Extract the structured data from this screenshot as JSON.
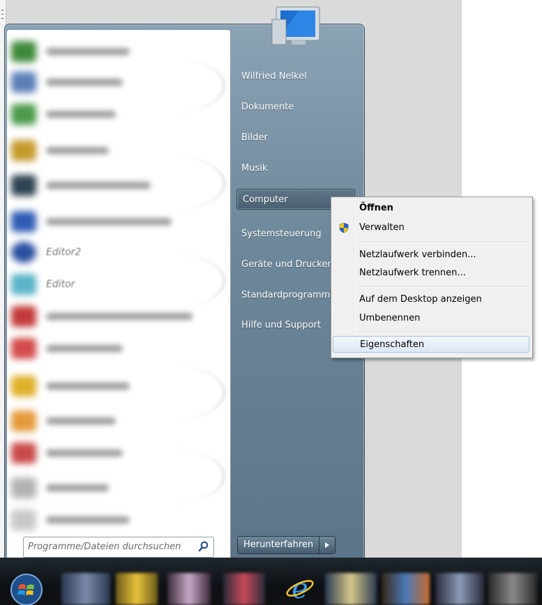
{
  "start_menu": {
    "right_pane": {
      "items": [
        {
          "label": "Wilfried Nelkel"
        },
        {
          "label": "Dokumente"
        },
        {
          "label": "Bilder"
        },
        {
          "label": "Musik"
        },
        {
          "label": "Computer"
        },
        {
          "label": "Systemsteuerung"
        },
        {
          "label": "Geräte und Drucker"
        },
        {
          "label": "Standardprogramme"
        },
        {
          "label": "Hilfe und Support"
        }
      ],
      "highlighted": "Computer"
    },
    "left_pane": {
      "blurred_labels": [
        "Editor",
        "Editor2"
      ]
    },
    "search": {
      "placeholder": "Programme/Dateien durchsuchen"
    },
    "shutdown_label": "Herunterfahren"
  },
  "context_menu": {
    "items": [
      {
        "label": "Öffnen",
        "bold": true
      },
      {
        "label": "Verwalten",
        "icon": "uac-shield-icon"
      },
      {
        "label": "Netzlaufwerk verbinden..."
      },
      {
        "label": "Netzlaufwerk trennen..."
      },
      {
        "label": "Auf dem Desktop anzeigen"
      },
      {
        "label": "Umbenennen"
      },
      {
        "label": "Eigenschaften",
        "selected": true
      }
    ]
  },
  "colors": {
    "start_menu_gradient_top": "#8aa3b5",
    "start_menu_gradient_bottom": "#5b7487",
    "context_menu_bg": "#f0f0f0",
    "selection_border": "#a8c3e0",
    "taskbar": "#0d1115"
  },
  "taskbar": {
    "icons": [
      "start-orb-icon",
      "internet-explorer-icon"
    ]
  }
}
